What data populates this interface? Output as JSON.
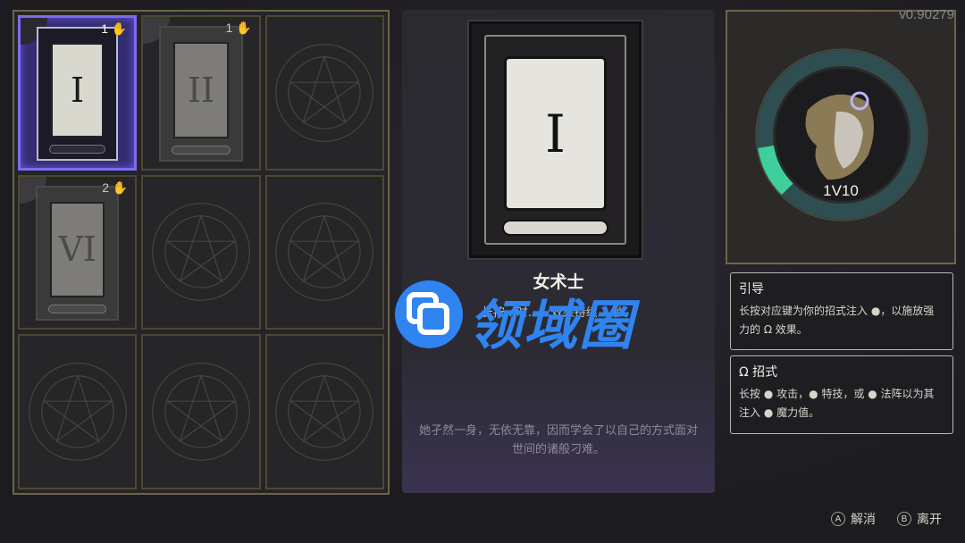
{
  "version": "v0.90279",
  "grid": {
    "slots": [
      {
        "numeral": "I",
        "level": "1",
        "state": "active"
      },
      {
        "numeral": "II",
        "level": "1",
        "state": "faded"
      },
      {
        "numeral": "",
        "level": "",
        "state": "empty"
      },
      {
        "numeral": "VI",
        "level": "2",
        "state": "faded"
      },
      {
        "numeral": "",
        "level": "",
        "state": "empty"
      },
      {
        "numeral": "",
        "level": "",
        "state": "empty"
      },
      {
        "numeral": "",
        "level": "",
        "state": "empty"
      },
      {
        "numeral": "",
        "level": "",
        "state": "empty"
      },
      {
        "numeral": "",
        "level": "",
        "state": "empty"
      }
    ]
  },
  "detail": {
    "numeral": "I",
    "title": "女术士",
    "description": "长按…时……效果持续 2 秒。",
    "lore": "她孑然一身，无依无靠，因而学会了以自己的方式面对世间的诸般刁难。"
  },
  "portrait": {
    "value": "1V10",
    "ring_fill": 0.1,
    "ring_color": "#3fcf9c"
  },
  "info": [
    {
      "title": "引导",
      "text": "长按对应键为你的招式注入 ●，以施放强力的 Ω 效果。"
    },
    {
      "title": "Ω 招式",
      "text": "长按 ● 攻击，● 特技，或 ● 法阵以为其注入 ● 魔力值。"
    }
  ],
  "buttons": {
    "cancel": {
      "key": "A",
      "label": "解消"
    },
    "leave": {
      "key": "B",
      "label": "离开"
    }
  },
  "watermark": {
    "text": "领域圈",
    "color": "#2f84f0"
  }
}
